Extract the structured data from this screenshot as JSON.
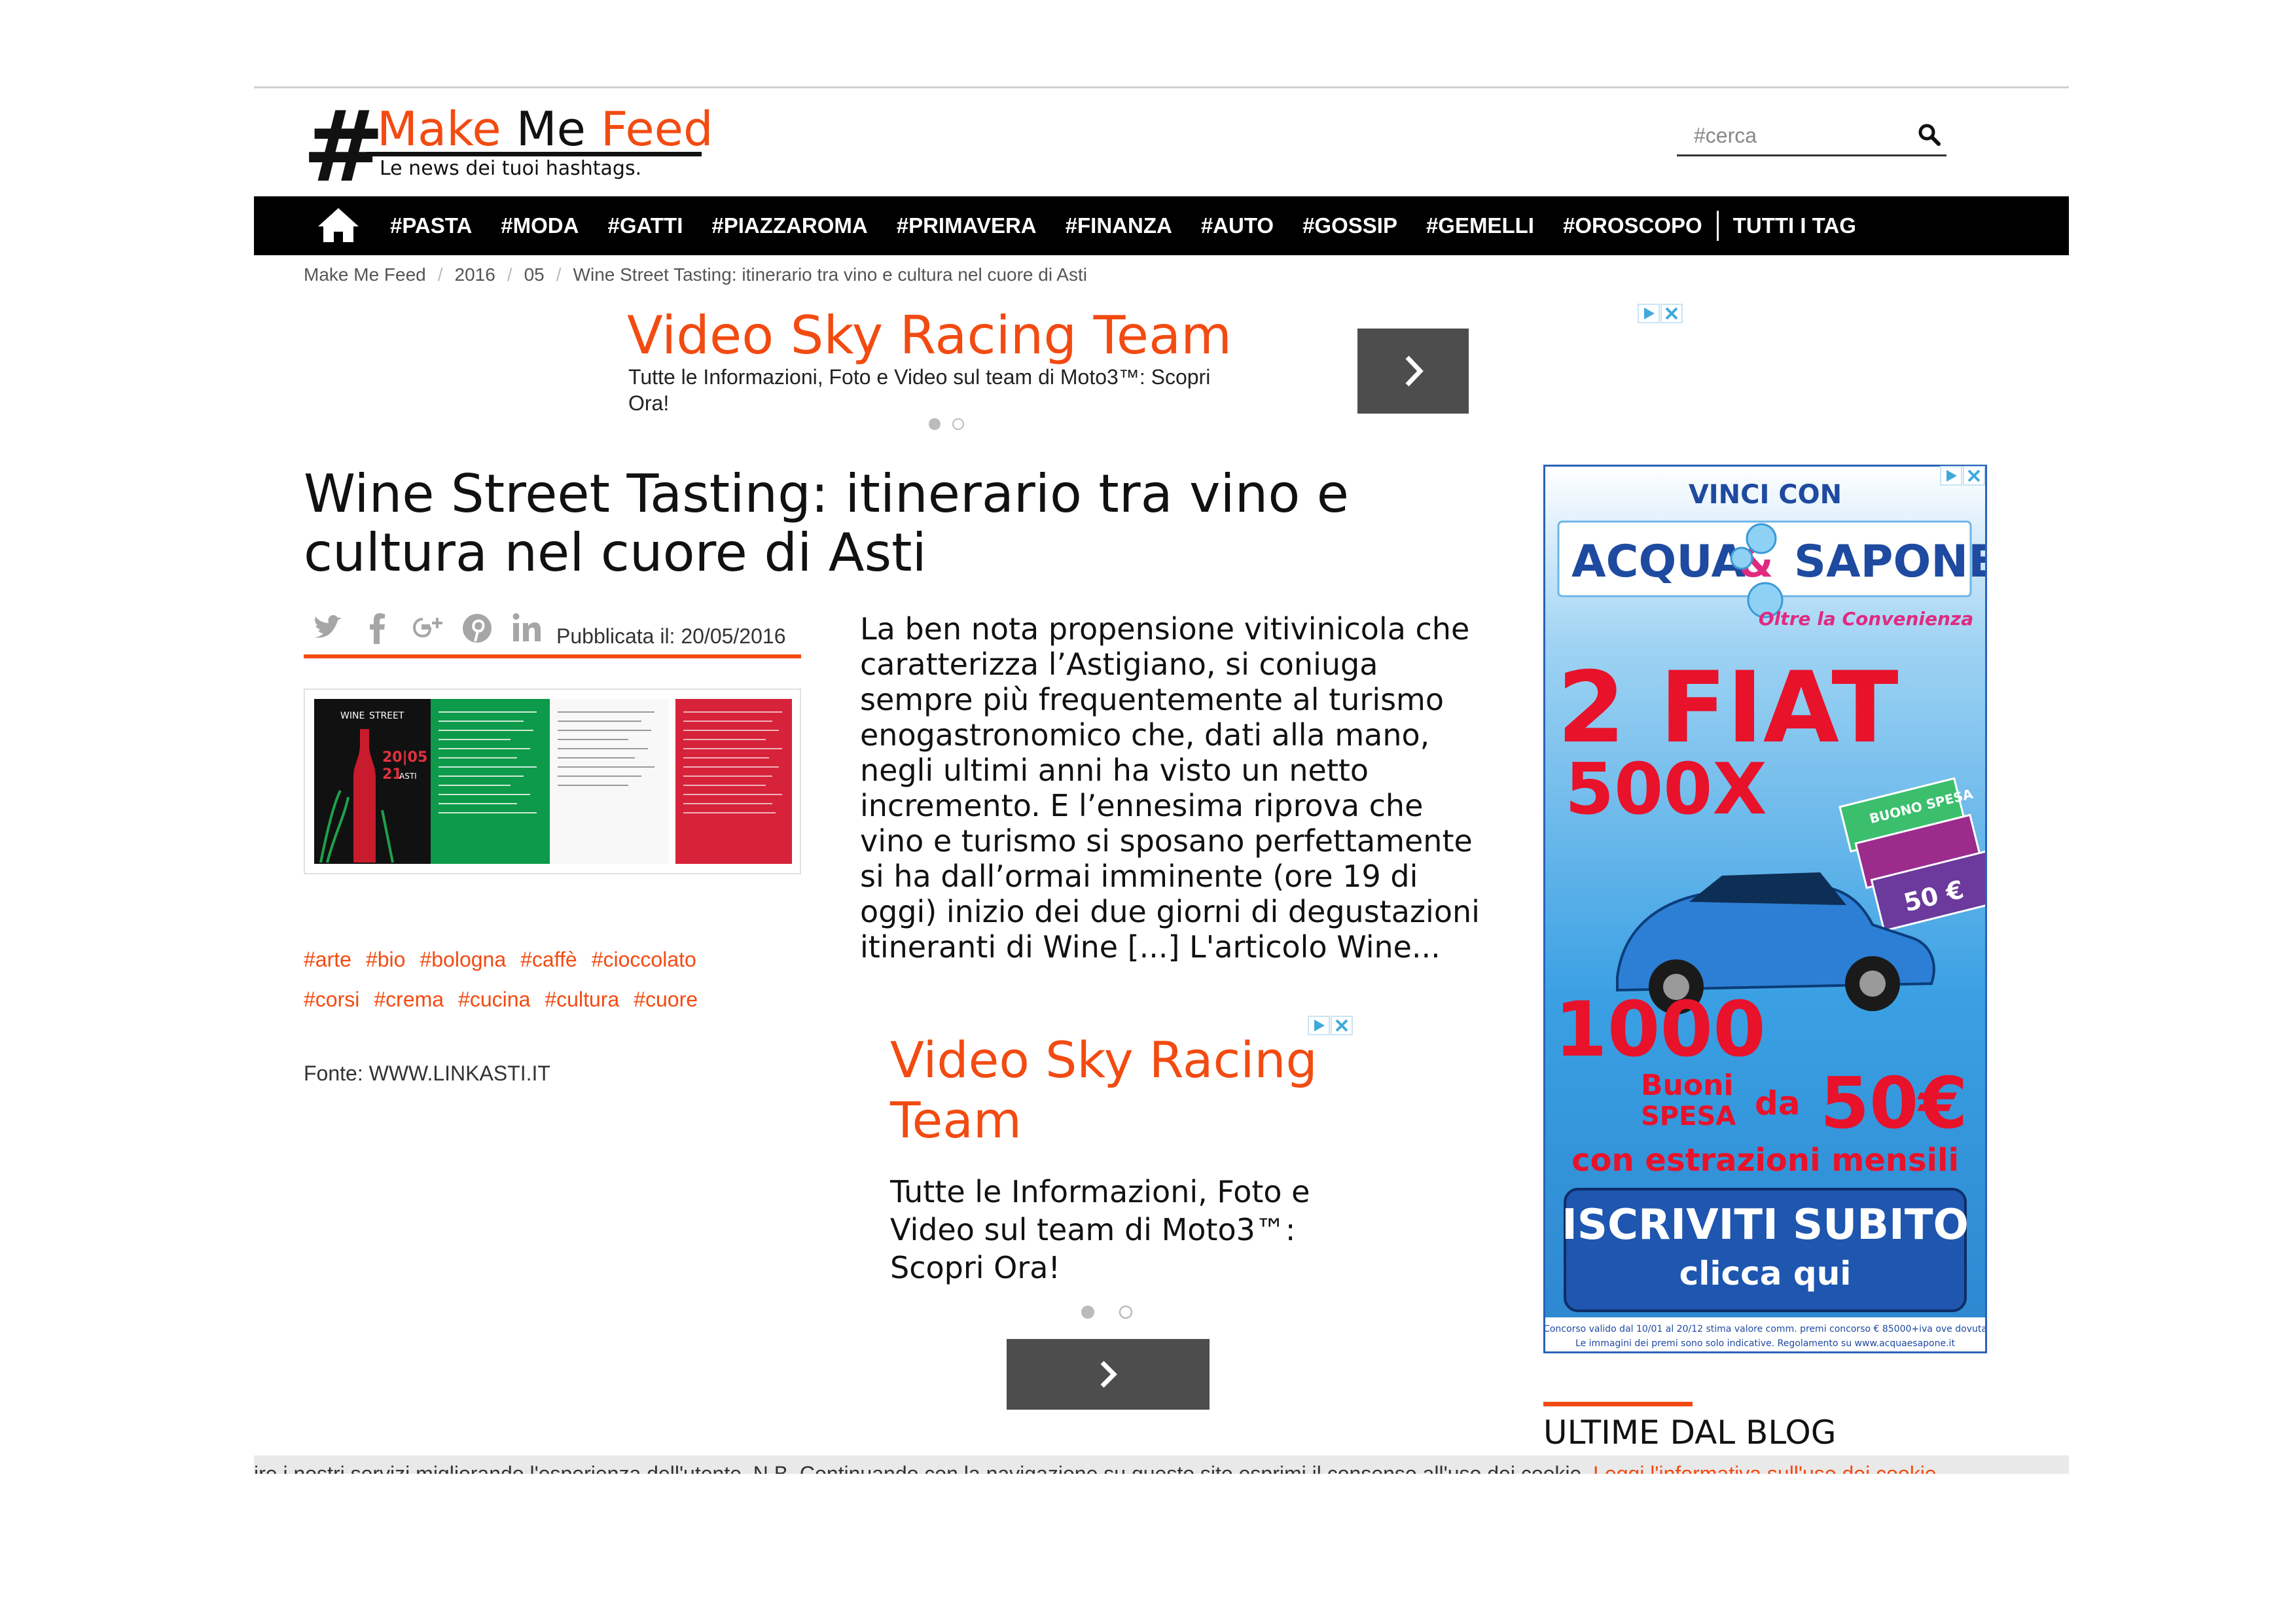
{
  "brand": {
    "hash": "#",
    "title_part1": "Make",
    "title_part2": "Me",
    "title_part3": "Feed",
    "tagline": "Le news dei tuoi hashtags.",
    "accent": "#f24b12"
  },
  "search": {
    "placeholder": "#cerca",
    "icon": "search-icon"
  },
  "nav": {
    "home_icon": "home-icon",
    "items": [
      "#PASTA",
      "#MODA",
      "#GATTI",
      "#PIAZZAROMA",
      "#PRIMAVERA",
      "#FINANZA",
      "#AUTO",
      "#GOSSIP",
      "#GEMELLI",
      "#OROSCOPO"
    ],
    "all_tags": "TUTTI I TAG"
  },
  "breadcrumb": [
    "Make Me Feed",
    "2016",
    "05",
    "Wine Street Tasting: itinerario tra vino e cultura nel cuore di Asti"
  ],
  "ad_top": {
    "title": "Video Sky Racing Team",
    "desc": "Tutte le Informazioni, Foto e Video sul team di Moto3™: Scopri Ora!"
  },
  "article": {
    "title": "Wine Street Tasting: itinerario tra vino e cultura nel cuore di Asti",
    "published_label": "Pubblicata il:",
    "published_date": "20/05/2016",
    "share_icons": [
      "twitter-icon",
      "facebook-icon",
      "google-plus-icon",
      "pinterest-icon",
      "linkedin-icon"
    ],
    "body": "La ben nota propensione vitivinicola che caratterizza l’Astigiano, si coniuga sempre più frequentemente al turismo enogastronomico che, dati alla mano, negli ultimi anni ha visto un netto incremento. E l’ennesima riprova che vino e turismo si sposano perfettamente si ha dall’ormai imminente (ore 19 di oggi) inizio dei due giorni di degustazioni itineranti di Wine [...] L'articolo Wine...",
    "tags_row1": [
      "#arte",
      "#bio",
      "#bologna",
      "#caffè",
      "#cioccolato"
    ],
    "tags_row2": [
      "#corsi",
      "#crema",
      "#cucina",
      "#cultura",
      "#cuore"
    ],
    "source_label": "Fonte:",
    "source_value": "WWW.LINKASTI.IT"
  },
  "ad_mid": {
    "title": "Video Sky Racing Team",
    "desc": "Tutte le Informazioni, Foto e Video sul team di Moto3™: Scopri Ora!"
  },
  "sidebar_ad": {
    "vinci_con": "VINCI CON",
    "brand_left": "ACQUA",
    "brand_amp": "&",
    "brand_right": "SAPONE",
    "brand_slogan": "Oltre la Convenienza",
    "headline1": "2 FIAT",
    "headline2": "500X",
    "coupon_text1": "BUONO SPESA",
    "coupon_value": "50 €",
    "count": "1000",
    "buoni": "Buoni",
    "spesa": "SPESA",
    "da": "da",
    "value": "50€",
    "estrazioni": "con estrazioni mensili",
    "cta1": "ISCRIVITI SUBITO",
    "cta2": "clicca qui",
    "fineprint1": "Concorso valido dal 10/01 al 20/12 stima valore comm. premi concorso € 85000+iva ove dovuta",
    "fineprint2": "Le immagini dei premi sono solo indicative. Regolamento su www.acquaesapone.it"
  },
  "sidebar": {
    "blog_heading": "ULTIME DAL BLOG"
  },
  "cookie": {
    "text": "ire i nostri servizi migliorando l'esperienza dell'utente. N.B. Continuando con la navigazione su questo sito esprimi il consenso all'uso dei cookie.",
    "link": "Leggi l'informativa sull'uso dei cookie"
  },
  "thumbnail": {
    "brand_top": "WINE",
    "brand_bottom": "STREET",
    "date_top": "20|05",
    "date_bottom": "21",
    "city": "ASTI"
  }
}
